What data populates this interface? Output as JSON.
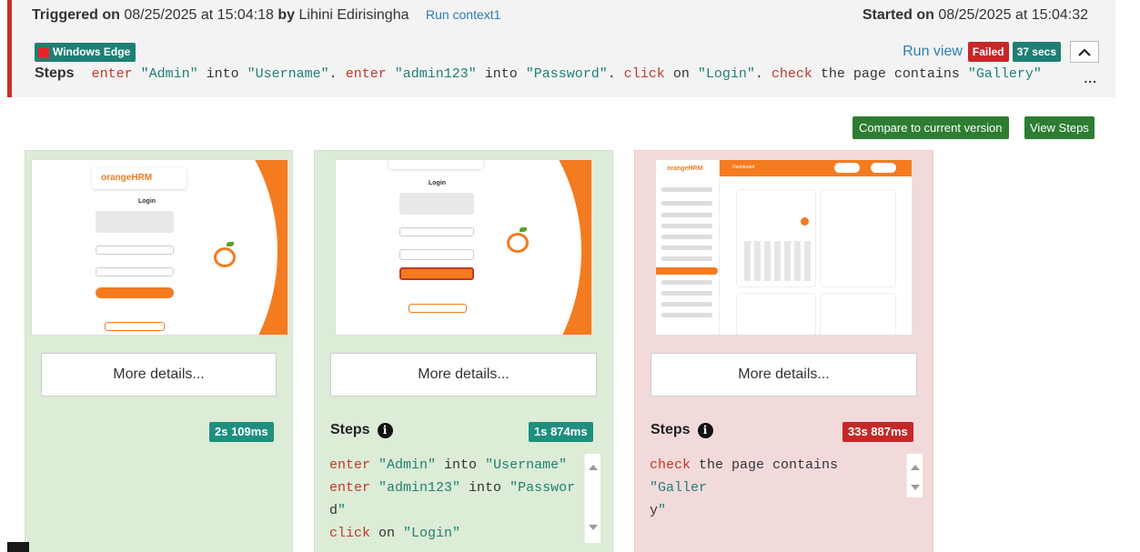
{
  "header": {
    "triggered_label": "Triggered on",
    "triggered_date": "08/25/2025 at 15:04:18",
    "by_label": "by",
    "user": "Lihini Edirisingha",
    "run_context": "Run context",
    "run_context_count": "1",
    "started_label": "Started on",
    "started_date": "08/25/2025 at 15:04:32",
    "environment": "Windows Edge",
    "run_view": "Run view",
    "status": "Failed",
    "duration": "37 secs",
    "steps_label": "Steps",
    "ellipsis": "..."
  },
  "summary_steps": [
    {
      "kw": "enter",
      "a": "\"Admin\"",
      "mid": "into",
      "b": "\"Username\"",
      "sep": "."
    },
    {
      "kw": "enter",
      "a": "\"admin123\"",
      "mid": "into",
      "b": "\"Password\"",
      "sep": "."
    },
    {
      "kw": "click",
      "a": "",
      "mid": "on",
      "b": "\"Login\"",
      "sep": "."
    },
    {
      "kw": "check",
      "a": "",
      "mid": "the page contains",
      "b": "\"Gallery\"",
      "sep": ""
    }
  ],
  "actions": {
    "compare": "Compare to current version",
    "view_steps": "View Steps"
  },
  "cards": [
    {
      "status": "passed",
      "more_details": "More details...",
      "time": "2s 109ms",
      "show_steps": false
    },
    {
      "status": "passed",
      "more_details": "More details...",
      "steps_title": "Steps",
      "time": "1s 874ms",
      "show_steps": true,
      "lines": [
        {
          "kw": "enter",
          "rest": " \"Admin\" into \"Username\""
        },
        {
          "kw": "enter",
          "rest": " \"admin123\" into \"Passwor"
        },
        {
          "kw": "",
          "rest": "d\""
        },
        {
          "kw": "click",
          "rest": " on \"Login\""
        }
      ]
    },
    {
      "status": "failed",
      "more_details": "More details...",
      "steps_title": "Steps",
      "time": "33s 887ms",
      "show_steps": true,
      "lines": [
        {
          "kw": "check",
          "rest": " the page contains \"Galler"
        },
        {
          "kw": "",
          "rest": "y\""
        }
      ]
    }
  ],
  "mini": {
    "login": "Login",
    "brand": "orangeHRM",
    "dashboard": "Dashboard"
  },
  "colors": {
    "accent_teal": "#1f7f74",
    "failed_red": "#c62828",
    "orange": "#f47b20",
    "keyword": "#c0392b"
  }
}
